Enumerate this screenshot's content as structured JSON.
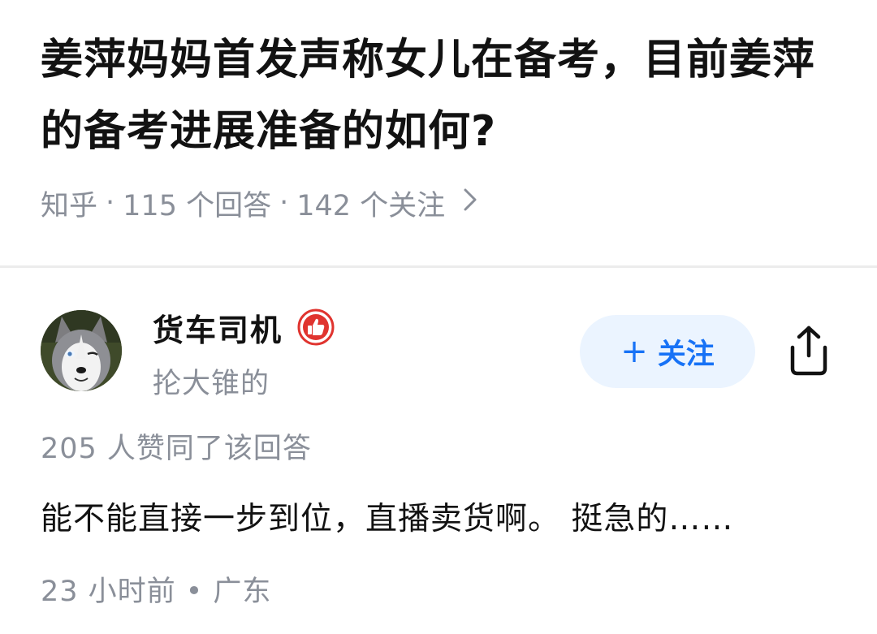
{
  "question": {
    "title": "姜萍妈妈首发声称女儿在备考，目前姜萍的备考进展准备的如何?",
    "source": "知乎",
    "answers": "115 个回答",
    "followers": "142 个关注"
  },
  "answer": {
    "author_name": "货车司机",
    "author_bio": "抡大锥的",
    "badge_icon": "thumbs-up-badge-icon",
    "follow_label": "关注",
    "votes_text": "205 人赞同了该回答",
    "content": "能不能直接一步到位，直播卖货啊。 挺急的……",
    "time": "23 小时前",
    "location": "广东"
  },
  "colors": {
    "accent": "#1772f6",
    "follow_bg": "#ebf4ff",
    "meta_gray": "#8a8f99",
    "badge_red": "#e0342f"
  }
}
